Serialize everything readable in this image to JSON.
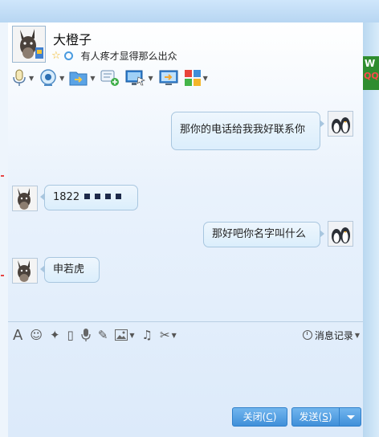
{
  "contact": {
    "name": "大橙子",
    "signature": "有人疼才显得那么出众"
  },
  "toolbar": {
    "items": [
      "voice-call",
      "video-call",
      "send-file",
      "add-contact",
      "remote-assist",
      "share-screen",
      "apps"
    ]
  },
  "messages": [
    {
      "side": "right",
      "sender": "me",
      "text": "那你的电话给我我好联系你"
    },
    {
      "side": "left",
      "sender": "contact",
      "text": "1822",
      "masked_digits": 4
    },
    {
      "side": "right",
      "sender": "me",
      "text": "那好吧你名字叫什么"
    },
    {
      "side": "left",
      "sender": "contact",
      "text": "申若虎"
    }
  ],
  "input_toolbar": {
    "history_label": "消息记录"
  },
  "buttons": {
    "close_label": "关闭(",
    "close_key": "C",
    "close_suffix": ")",
    "send_label": "发送(",
    "send_key": "S",
    "send_suffix": ")"
  },
  "side_ad": {
    "line1": "W",
    "line2": "QQ"
  },
  "colors": {
    "accent": "#3f8fd9",
    "bubble_border": "#a8c6df",
    "bubble_fill": "#dbeefc"
  }
}
